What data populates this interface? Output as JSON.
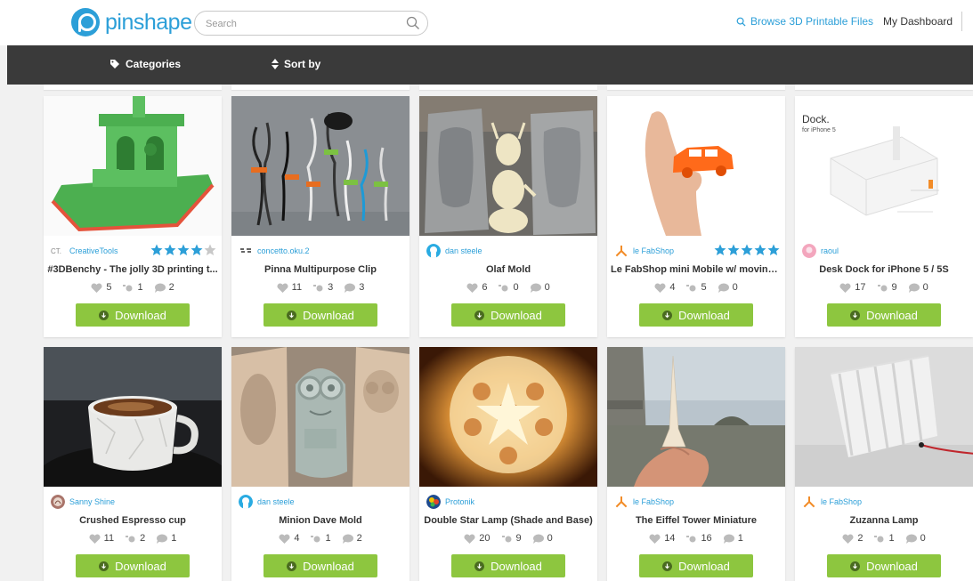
{
  "header": {
    "logo_text": "pinshape",
    "search_placeholder": "Search",
    "search_value": "",
    "browse_label": "Browse 3D Printable Files",
    "dashboard_label": "My Dashboard"
  },
  "nav": {
    "categories_label": "Categories",
    "sort_label": "Sort by"
  },
  "colors": {
    "brand": "#2c9fd8",
    "download": "#8dc63f",
    "nav_bg": "#3a3a3a",
    "star": "#2c9fd8"
  },
  "download_label": "Download",
  "cards": [
    {
      "author": "CreativeTools",
      "title": "#3DBenchy - The jolly 3D printing t...",
      "likes": "5",
      "makes": "1",
      "comments": "2",
      "stars": 4,
      "avatar_icon": "ct-logo-icon"
    },
    {
      "author": "concetto.oku.2",
      "title": "Pinna Multipurpose Clip",
      "likes": "11",
      "makes": "3",
      "comments": "3",
      "stars": 0,
      "avatar_icon": "oku-logo-icon"
    },
    {
      "author": "dan steele",
      "title": "Olaf Mold",
      "likes": "6",
      "makes": "0",
      "comments": "0",
      "stars": 0,
      "avatar_icon": "user-avatar-icon"
    },
    {
      "author": "le FabShop",
      "title": "Le FabShop mini Mobile w/ moving ...",
      "likes": "4",
      "makes": "5",
      "comments": "0",
      "stars": 5,
      "avatar_icon": "fabshop-logo-icon"
    },
    {
      "author": "raoul",
      "title": "Desk Dock for iPhone 5 / 5S",
      "likes": "17",
      "makes": "9",
      "comments": "0",
      "stars": 0,
      "avatar_icon": "pink-avatar-icon"
    },
    {
      "author": "Sanny Shine",
      "title": "Crushed Espresso cup",
      "likes": "11",
      "makes": "2",
      "comments": "1",
      "stars": 0,
      "avatar_icon": "photo-avatar-icon"
    },
    {
      "author": "dan steele",
      "title": "Minion Dave Mold",
      "likes": "4",
      "makes": "1",
      "comments": "2",
      "stars": 0,
      "avatar_icon": "user-avatar-icon"
    },
    {
      "author": "Protonik",
      "title": "Double Star Lamp (Shade and Base)",
      "likes": "20",
      "makes": "9",
      "comments": "0",
      "stars": 0,
      "avatar_icon": "colorful-avatar-icon"
    },
    {
      "author": "le FabShop",
      "title": "The Eiffel Tower Miniature",
      "likes": "14",
      "makes": "16",
      "comments": "1",
      "stars": 0,
      "avatar_icon": "fabshop-logo-icon"
    },
    {
      "author": "le FabShop",
      "title": "Zuzanna Lamp",
      "likes": "2",
      "makes": "1",
      "comments": "0",
      "stars": 0,
      "avatar_icon": "fabshop-logo-icon"
    }
  ],
  "image_texts": {
    "dock_title": "Dock.",
    "dock_subtitle": "for iPhone 5"
  }
}
